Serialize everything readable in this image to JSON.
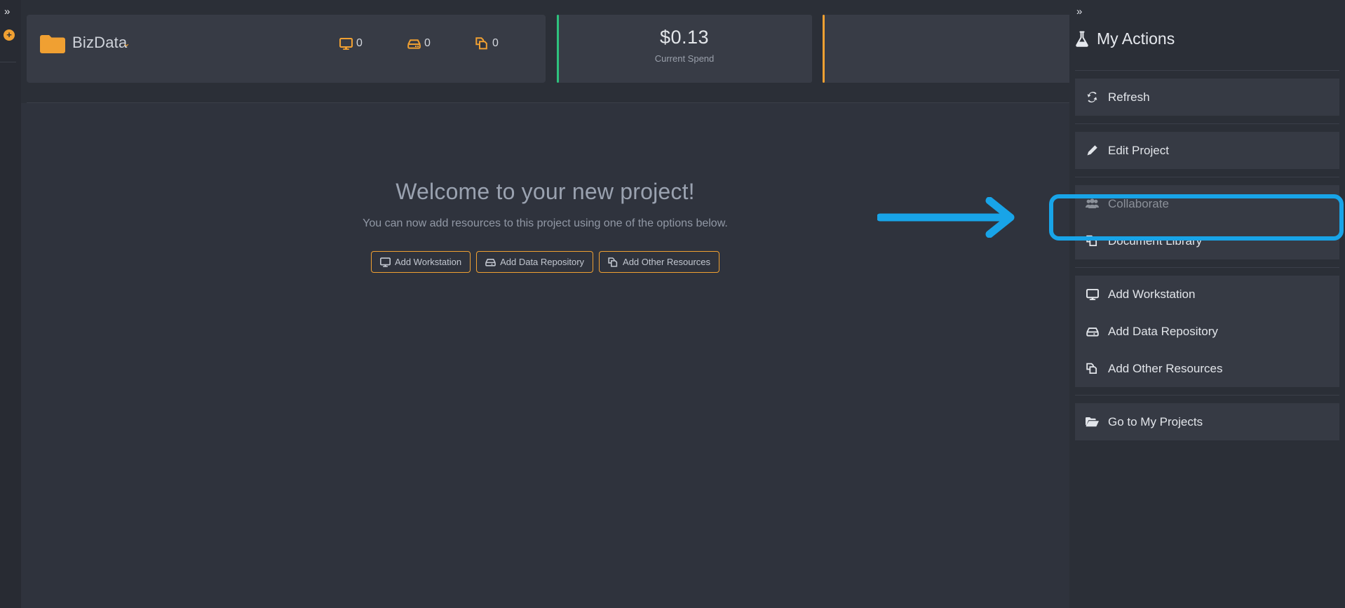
{
  "left_rail": {
    "expand_icon": "chevron-double-right-icon",
    "add_icon": "plus-circle-icon"
  },
  "header": {
    "project": {
      "folder_icon": "folder-icon",
      "name": "BizData",
      "caret": "chevron-double-down-icon",
      "stats": [
        {
          "icon": "workstation-icon",
          "count": "0"
        },
        {
          "icon": "data-repository-icon",
          "count": "0"
        },
        {
          "icon": "other-resources-icon",
          "count": "0"
        }
      ]
    },
    "metrics": [
      {
        "value": "$0.13",
        "label": "Current Spend",
        "accent": "#2ec27e"
      },
      {
        "value": "",
        "label": "",
        "accent": "#f0a032"
      }
    ]
  },
  "welcome": {
    "title": "Welcome to your new project!",
    "subtitle": "You can now add resources to this project using one of the options below.",
    "buttons": [
      {
        "icon": "workstation-icon",
        "label": "Add Workstation"
      },
      {
        "icon": "data-repository-icon",
        "label": "Add Data Repository"
      },
      {
        "icon": "other-resources-icon",
        "label": "Add Other Resources"
      }
    ]
  },
  "sidebar": {
    "collapse_icon": "chevron-double-right-icon",
    "title_icon": "flask-icon",
    "title": "My Actions",
    "items": [
      {
        "icon": "refresh-icon",
        "label": "Refresh",
        "disabled": false
      },
      {
        "icon": "pencil-icon",
        "label": "Edit Project",
        "disabled": false
      },
      {
        "icon": "users-icon",
        "label": "Collaborate",
        "disabled": true
      },
      {
        "icon": "document-library-icon",
        "label": "Document Library",
        "disabled": false
      },
      {
        "icon": "workstation-icon",
        "label": "Add Workstation",
        "disabled": false
      },
      {
        "icon": "data-repository-icon",
        "label": "Add Data Repository",
        "disabled": false
      },
      {
        "icon": "other-resources-icon",
        "label": "Add Other Resources",
        "disabled": false
      },
      {
        "icon": "folder-open-icon",
        "label": "Go to My Projects",
        "disabled": false
      }
    ]
  },
  "annotation": {
    "arrow_color": "#18a4e8",
    "highlight_color": "#18a4e8",
    "highlight_target": "Collaborate"
  },
  "colors": {
    "accent_orange": "#f0a032",
    "accent_green": "#2ec27e",
    "annotation_blue": "#18a4e8",
    "app_background": "#2f333d",
    "panel_background": "#2b2f37",
    "card_background": "#373b45"
  }
}
